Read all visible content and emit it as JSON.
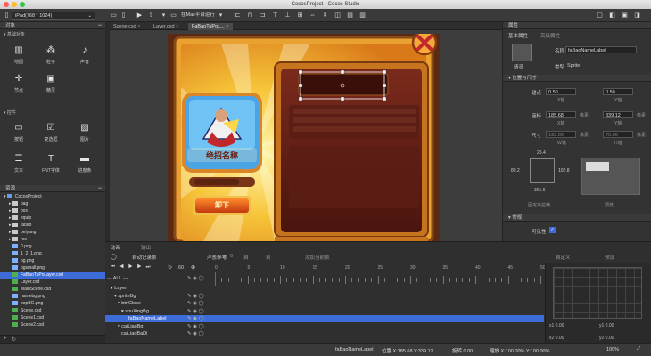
{
  "window": {
    "title": "CocosProject - Cocos Studio"
  },
  "toolbar": {
    "device": "iPad(768 * 1024)",
    "run_target": "在Mac平台运行"
  },
  "left": {
    "objects_header": "对象",
    "basic_header": "基础对象",
    "basic": [
      {
        "label": "地图",
        "icon": "map-icon",
        "glyph": "▥"
      },
      {
        "label": "粒子",
        "icon": "particle-icon",
        "glyph": "⁂"
      },
      {
        "label": "声音",
        "icon": "sound-icon",
        "glyph": "♪"
      },
      {
        "label": "节点",
        "icon": "node-icon",
        "glyph": "✛"
      },
      {
        "label": "精灵",
        "icon": "sprite-icon",
        "glyph": "▣"
      }
    ],
    "controls_header": "控件",
    "controls": [
      {
        "label": "按钮",
        "icon": "button-icon",
        "glyph": "▭"
      },
      {
        "label": "复选框",
        "icon": "checkbox-icon",
        "glyph": "☑"
      },
      {
        "label": "图片",
        "icon": "image-icon",
        "glyph": "▨"
      },
      {
        "label": "文本",
        "icon": "text-icon",
        "glyph": "☰"
      },
      {
        "label": "FNT字体",
        "icon": "fnt-icon",
        "glyph": "T"
      },
      {
        "label": "进度条",
        "icon": "progress-icon",
        "glyph": "▬"
      }
    ],
    "resources_header": "资源",
    "resources": [
      "CocosProject",
      "bag",
      "box",
      "equip",
      "fabao",
      "peiyang",
      "res",
      "0.png",
      "1_2_1.png",
      "bg.png",
      "bgsmall.png",
      "FaBaoTuPoLayer.csd",
      "Layer.csd",
      "MainScene.csd",
      "namebg.png",
      "popBG.png",
      "Scene.csd",
      "Scene1.csd",
      "Scene2.csd"
    ]
  },
  "tabs": [
    "Scene.csd",
    "Layer.csd",
    "FaBaoTuPoL..."
  ],
  "game": {
    "skill_name": "绝招名称",
    "button": "卸下"
  },
  "right": {
    "header": "属性",
    "tab_basic": "基本属性",
    "tab_advanced": "高级属性",
    "thumb_label": "精灵",
    "name_label": "名称",
    "name_value": "faBaoNameLabel",
    "type_label": "类型",
    "type_value": "Sprite",
    "pos_header": "位置与尺寸",
    "anchor_label": "锚点",
    "anchor_x": "0.50",
    "anchor_y": "0.50",
    "x_unit": "X轴",
    "y_unit": "Y轴",
    "pos_label": "座标",
    "pos_x": "185.68",
    "pos_y": "339.12",
    "px_unit": "像素",
    "size_label": "尺寸",
    "size_w": "193.00",
    "size_h": "75.00",
    "w_unit": "W轴",
    "h_unit": "H轴",
    "margin_top": "26.4",
    "margin_left": "89.2",
    "margin_right": "102.8",
    "margin_bottom": "301.6",
    "pos_caption": "固定与拉伸",
    "preview_caption": "预览",
    "general_header": "常规",
    "visible_label": "可见性"
  },
  "timeline": {
    "tab_anim": "动画",
    "tab_out": "输出",
    "auto_record": "自动记录帧",
    "onion": "洋葱参考",
    "frame_label": "帧",
    "frame_value": "0",
    "from_label": "自",
    "to_label": "到",
    "add_label": "添加当前帧",
    "fps": "60",
    "filter": "--- ALL ---",
    "ruler": [
      "0",
      "5",
      "10",
      "15",
      "20",
      "25",
      "30",
      "35",
      "40",
      "45",
      "50"
    ],
    "custom": "自定义",
    "preset": "预设",
    "layers": [
      "Layer",
      "spriteBg",
      "btnClose",
      "shuXingBg",
      "faBaoNameLabel",
      "caiLiaoBg",
      "caiLiaoBaDi"
    ],
    "curve": {
      "x1": "x1  0.00",
      "y1": "y1  0.00",
      "x2": "x2  0.00",
      "y2": "y2  0.00"
    }
  },
  "status": {
    "node": "faBaoNameLabel",
    "position": "位置 X:185.68  Y:339.12",
    "rotation": "旋转 0.00",
    "scale": "缩放 X:100.00%   Y:100.00%",
    "zoom": "100%"
  }
}
